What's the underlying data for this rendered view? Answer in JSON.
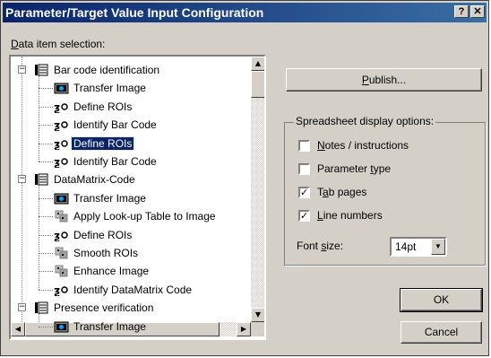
{
  "window": {
    "title": "Parameter/Target Value Input Configuration",
    "help_button": "?",
    "close_button": "✕"
  },
  "data_item_label_prefix": "D",
  "data_item_label_rest": "ata item selection:",
  "tree": {
    "items": [
      {
        "label": "Bar code identification",
        "kind": "group",
        "expanded": true
      },
      {
        "label": "Transfer Image",
        "kind": "transfer"
      },
      {
        "label": "Define ROIs",
        "kind": "tool"
      },
      {
        "label": "Identify Bar Code",
        "kind": "tool"
      },
      {
        "label": "Define ROIs",
        "kind": "tool",
        "selected": true
      },
      {
        "label": "Identify Bar Code",
        "kind": "tool"
      },
      {
        "label": "DataMatrix-Code",
        "kind": "group",
        "expanded": true
      },
      {
        "label": "Transfer Image",
        "kind": "transfer"
      },
      {
        "label": "Apply Look-up Table to Image",
        "kind": "filter"
      },
      {
        "label": "Define ROIs",
        "kind": "tool"
      },
      {
        "label": "Smooth ROIs",
        "kind": "filter"
      },
      {
        "label": "Enhance Image",
        "kind": "filter"
      },
      {
        "label": "Identify DataMatrix Code",
        "kind": "tool"
      },
      {
        "label": "Presence verification",
        "kind": "group",
        "expanded": true
      },
      {
        "label": "Transfer Image",
        "kind": "transfer"
      }
    ]
  },
  "buttons": {
    "publish_u": "P",
    "publish_rest": "ublish...",
    "ok": "OK",
    "cancel": "Cancel"
  },
  "options": {
    "group_label": "Spreadsheet display options:",
    "notes_u": "N",
    "notes_rest": "otes / instructions",
    "notes_checked": false,
    "ptype_a": "Parameter ",
    "ptype_u": "t",
    "ptype_b": "ype",
    "ptype_checked": false,
    "tab_a": "T",
    "tab_u": "a",
    "tab_b": "b pages",
    "tab_checked": true,
    "line_u": "L",
    "line_rest": "ine numbers",
    "line_checked": true,
    "font_a": "Font ",
    "font_u": "s",
    "font_b": "ize:",
    "font_value": "14pt"
  }
}
